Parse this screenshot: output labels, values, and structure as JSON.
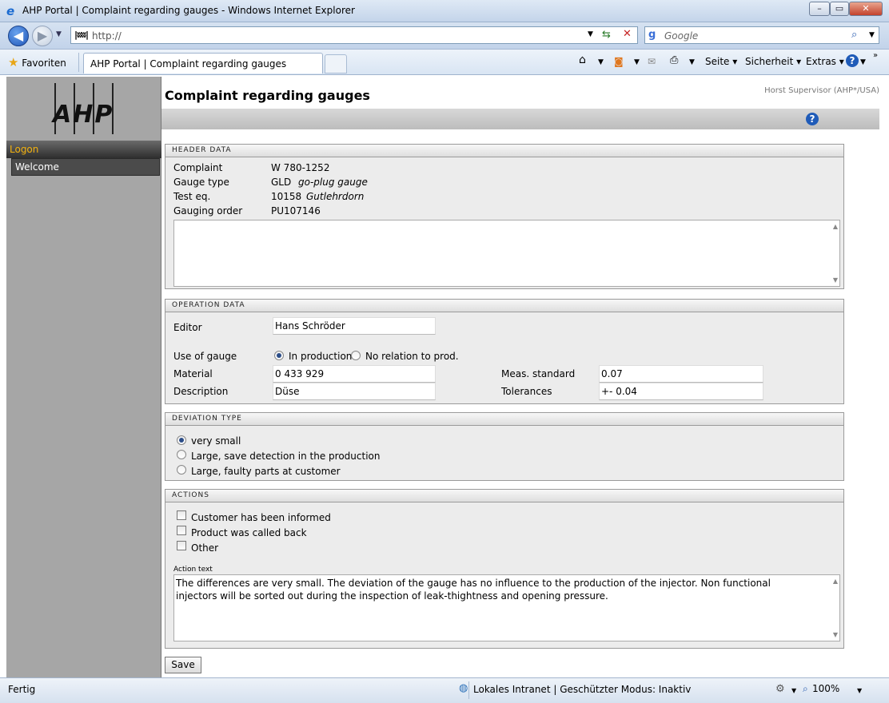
{
  "window": {
    "title": "AHP Portal | Complaint regarding gauges - Windows Internet Explorer",
    "minimize": "–",
    "maximize": "▭",
    "close": "✕"
  },
  "browser": {
    "url": "http://",
    "search_placeholder": "Google",
    "favorites_label": "Favoriten",
    "tab_title": "AHP Portal | Complaint regarding gauges",
    "cmd_page": "Seite ▾",
    "cmd_security": "Sicherheit ▾",
    "cmd_extras": "Extras ▾",
    "status": "Fertig",
    "zone": "Lokales Intranet | Geschützter Modus: Inaktiv",
    "zoom": "100%",
    "icons": [
      "ie-icon",
      "back-arrow-icon",
      "forward-arrow-icon",
      "refresh-icon",
      "stop-icon",
      "search-icon",
      "star-icon",
      "home-icon",
      "rss-icon",
      "mail-icon",
      "print-icon",
      "help-icon",
      "globe-icon"
    ]
  },
  "sidebar": {
    "logo": "AHP",
    "section": "Logon",
    "items": [
      {
        "label": "Welcome"
      }
    ]
  },
  "page": {
    "title": "Complaint regarding gauges",
    "user": "Horst Supervisor (AHP*/USA)"
  },
  "header_data": {
    "heading": "HEADER DATA",
    "complaint_label": "Complaint",
    "complaint_value": "W 780-1252",
    "gauge_type_label": "Gauge type",
    "gauge_type_code": "GLD",
    "gauge_type_name": "go-plug gauge",
    "test_eq_label": "Test eq.",
    "test_eq_code": "10158",
    "test_eq_name": "Gutlehrdorn",
    "gauging_order_label": "Gauging order",
    "gauging_order_value": "PU107146",
    "notes": ""
  },
  "operation_data": {
    "heading": "OPERATION DATA",
    "editor_label": "Editor",
    "editor_value": "Hans Schröder",
    "use_label": "Use of gauge",
    "use_option_1": "In production",
    "use_option_2": "No relation to prod.",
    "use_selected": "In production",
    "material_label": "Material",
    "material_value": "0 433 929",
    "description_label": "Description",
    "description_value": "Düse",
    "meas_label": "Meas. standard",
    "meas_value": "0.07",
    "tolerances_label": "Tolerances",
    "tolerances_value": "+- 0.04"
  },
  "deviation_type": {
    "heading": "DEVIATION TYPE",
    "option_1": "very small",
    "option_2": "Large, save detection in the production",
    "option_3": "Large, faulty parts at customer",
    "selected": "very small"
  },
  "actions": {
    "heading": "ACTIONS",
    "check_1": "Customer has been informed",
    "check_2": "Product was called back",
    "check_3": "Other",
    "text_label": "Action text",
    "text_value": "The differences are very small. The deviation of the gauge has no influence to the production of the injector. Non functional injectors will be sorted out during the inspection of leak-thightness and opening pressure."
  },
  "save_label": "Save"
}
